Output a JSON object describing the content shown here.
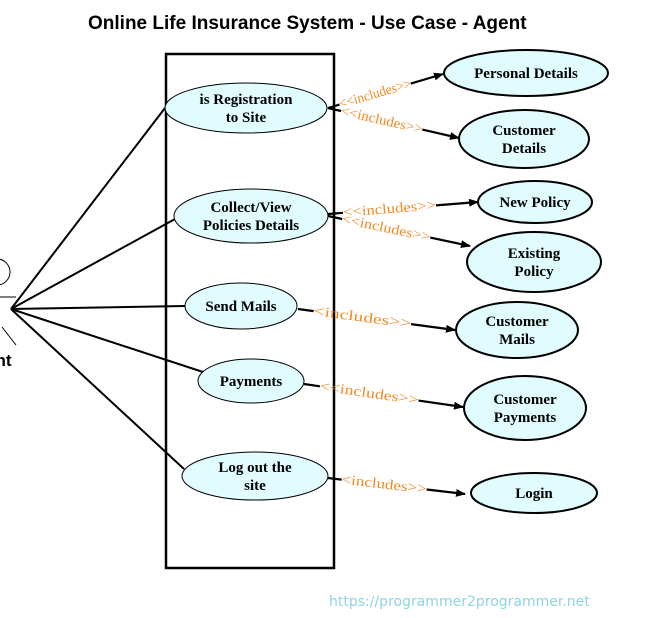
{
  "title": "Online Life Insurance System - Use Case - Agent",
  "actor": {
    "name": "Agent",
    "visible_label": "ent",
    "icon": "stick-figure-icon"
  },
  "system_boundary": {
    "label": ""
  },
  "colors": {
    "use_case_fill": "#E0FCFF",
    "relation_label": "#F08A24",
    "watermark": "#8FD3E6",
    "lines": "#000000"
  },
  "use_cases": [
    {
      "id": "registration",
      "lines": [
        "is Registration",
        "to Site"
      ]
    },
    {
      "id": "collect-view",
      "lines": [
        "Collect/View",
        "Policies Details"
      ]
    },
    {
      "id": "send-mails",
      "lines": [
        "Send Mails"
      ]
    },
    {
      "id": "payments",
      "lines": [
        "Payments"
      ]
    },
    {
      "id": "logout",
      "lines": [
        "Log out the",
        "site"
      ]
    }
  ],
  "included_use_cases": [
    {
      "id": "personal-details",
      "lines": [
        "Personal Details"
      ]
    },
    {
      "id": "customer-details",
      "lines": [
        "Customer",
        "Details"
      ]
    },
    {
      "id": "new-policy",
      "lines": [
        "New Policy"
      ]
    },
    {
      "id": "existing-policy",
      "lines": [
        "Existing",
        "Policy"
      ]
    },
    {
      "id": "customer-mails",
      "lines": [
        "Customer",
        "Mails"
      ]
    },
    {
      "id": "customer-payments",
      "lines": [
        "Customer",
        "Payments"
      ]
    },
    {
      "id": "login",
      "lines": [
        "Login"
      ]
    }
  ],
  "relations": [
    {
      "from": "registration",
      "to": "personal-details",
      "label": "<<includes>>"
    },
    {
      "from": "registration",
      "to": "customer-details",
      "label": "<<includes>>"
    },
    {
      "from": "collect-view",
      "to": "new-policy",
      "label": "<<includes>>"
    },
    {
      "from": "collect-view",
      "to": "existing-policy",
      "label": "<<includes>>"
    },
    {
      "from": "send-mails",
      "to": "customer-mails",
      "label": "<includes>>"
    },
    {
      "from": "payments",
      "to": "customer-payments",
      "label": "<<includes>>"
    },
    {
      "from": "logout",
      "to": "login",
      "label": "<includes>>"
    }
  ],
  "watermark": "https://programmer2programmer.net"
}
